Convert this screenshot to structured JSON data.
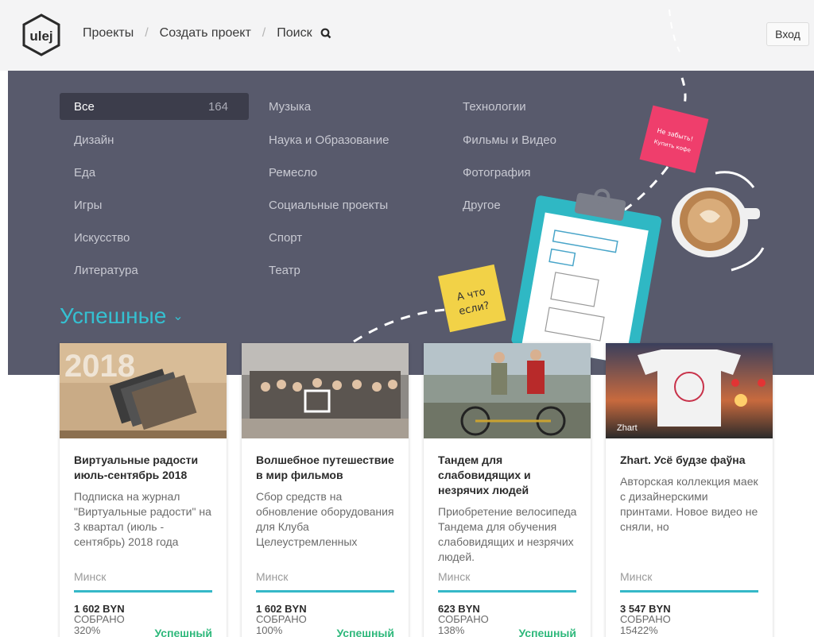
{
  "nav": {
    "projects": "Проекты",
    "create": "Создать проект",
    "search": "Поиск",
    "login": "Вход"
  },
  "categories": {
    "all_label": "Все",
    "all_count": "164",
    "col1": [
      "Дизайн",
      "Еда",
      "Игры",
      "Искусство",
      "Литература"
    ],
    "col2": [
      "Музыка",
      "Наука и Образование",
      "Ремесло",
      "Социальные проекты",
      "Спорт",
      "Театр"
    ],
    "col3": [
      "Технологии",
      "Фильмы и Видео",
      "Фотография",
      "Другое"
    ]
  },
  "section_title": "Успешные",
  "deco": {
    "sticky_yellow": "А что если?",
    "sticky_pink": "Не забыть! Купить кофе",
    "magazine_year": "2018",
    "photo_watermark": "Zhart"
  },
  "cards": [
    {
      "title": "Виртуальные радости июль-сентябрь 2018",
      "desc": "Подписка на журнал \"Виртуальные радости\" на 3 квартал (июль - сентябрь) 2018 года",
      "city": "Минск",
      "amount": "1 602 BYN",
      "funded": "СОБРАНО 320%",
      "status": "Успешный"
    },
    {
      "title": "Волшебное путешествие в мир фильмов",
      "desc": "Сбор средств на обновление оборудования для Клуба Целеустремленных",
      "city": "Минск",
      "amount": "1 602 BYN",
      "funded": "СОБРАНО 100%",
      "status": "Успешный"
    },
    {
      "title": "Тандем для слабовидящих и незрячих людей",
      "desc": "Приобретение велосипеда Тандема для обучения слабовидящих и незрячих людей.",
      "city": "Минск",
      "amount": "623 BYN",
      "funded": "СОБРАНО 138%",
      "status": "Успешный"
    },
    {
      "title": "Zhart. Усё будзе фаўна",
      "desc": "Авторская коллекция маек с дизайнерскими принтами. Новое видео не сняли, но",
      "city": "Минск",
      "amount": "3 547 BYN",
      "funded": "СОБРАНО 15422%",
      "status": ""
    }
  ],
  "colors": {
    "accent": "#35c0d1",
    "hero_bg": "#585a6c",
    "success": "#2eb87b"
  }
}
